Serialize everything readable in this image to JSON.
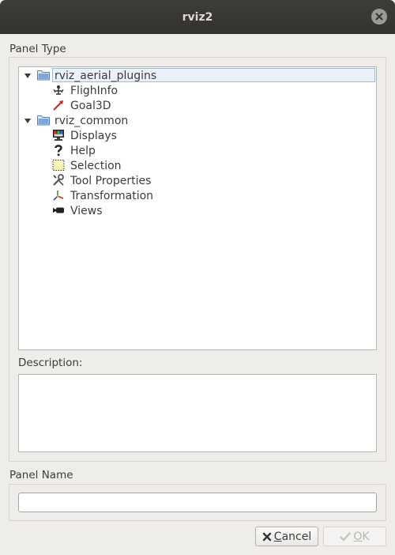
{
  "window": {
    "title": "rviz2"
  },
  "panel_type": {
    "label": "Panel Type",
    "groups": [
      {
        "label": "rviz_aerial_plugins",
        "expanded": true,
        "selected": true,
        "icon": "folder-icon",
        "items": [
          {
            "label": "FlighInfo",
            "icon": "drone-icon"
          },
          {
            "label": "Goal3D",
            "icon": "arrow-icon"
          }
        ]
      },
      {
        "label": "rviz_common",
        "expanded": true,
        "icon": "folder-icon",
        "items": [
          {
            "label": "Displays",
            "icon": "monitor-icon"
          },
          {
            "label": "Help",
            "icon": "question-icon"
          },
          {
            "label": "Selection",
            "icon": "selection-icon"
          },
          {
            "label": "Tool Properties",
            "icon": "tools-icon"
          },
          {
            "label": "Transformation",
            "icon": "axes-icon"
          },
          {
            "label": "Views",
            "icon": "camera-icon"
          }
        ]
      }
    ]
  },
  "description": {
    "label": "Description:",
    "text": ""
  },
  "panel_name": {
    "label": "Panel Name",
    "value": "",
    "placeholder": ""
  },
  "buttons": {
    "cancel_mnemonic": "C",
    "cancel_rest": "ancel",
    "ok_mnemonic": "O",
    "ok_rest": "K",
    "ok_enabled": false
  },
  "colors": {
    "titlebar": "#35342f",
    "selection_border": "#9fbbd8",
    "selection_fill": "#ebf1f7",
    "folder": "#5a8fd0"
  }
}
